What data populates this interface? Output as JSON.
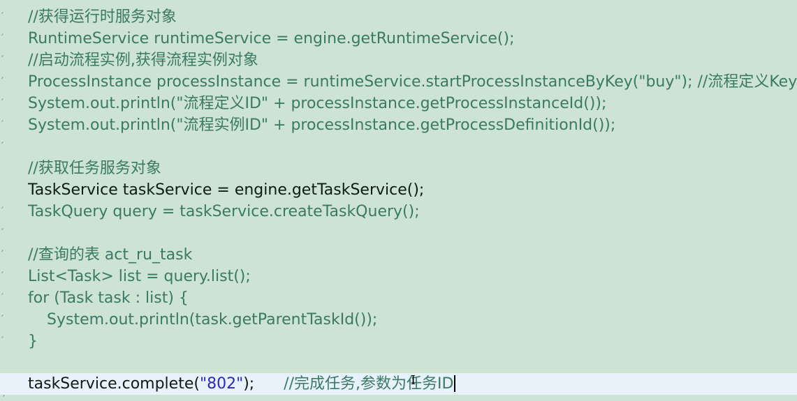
{
  "lines": [
    "//获得运行时服务对象",
    "RuntimeService runtimeService = engine.getRuntimeService();",
    "//启动流程实例,获得流程实例对象",
    "ProcessInstance processInstance = runtimeService.startProcessInstanceByKey(\"buy\"); //流程定义Key",
    "System.out.println(\"流程定义ID\" + processInstance.getProcessInstanceId());",
    "System.out.println(\"流程实例ID\" + processInstance.getProcessDefinitionId());",
    "",
    "//获取任务服务对象",
    "TaskService taskService = engine.getTaskService();",
    "TaskQuery query = taskService.createTaskQuery();",
    "",
    "//查询的表 act_ru_task",
    "List<Task> list = query.list();",
    "for (Task task : list) {",
    "System.out.println(task.getParentTaskId());",
    "}",
    ""
  ],
  "current_line": {
    "code": "taskService.complete(",
    "string": "\"802\"",
    "rest": ");",
    "comment": "//完成任务,参数为任务ID"
  },
  "colors": {
    "background": "#cde3d4",
    "current_line_bg": "#e8f2fb",
    "code_text": "#3a7a64",
    "active_text": "#0e1a14",
    "string": "#2a2ab8"
  }
}
